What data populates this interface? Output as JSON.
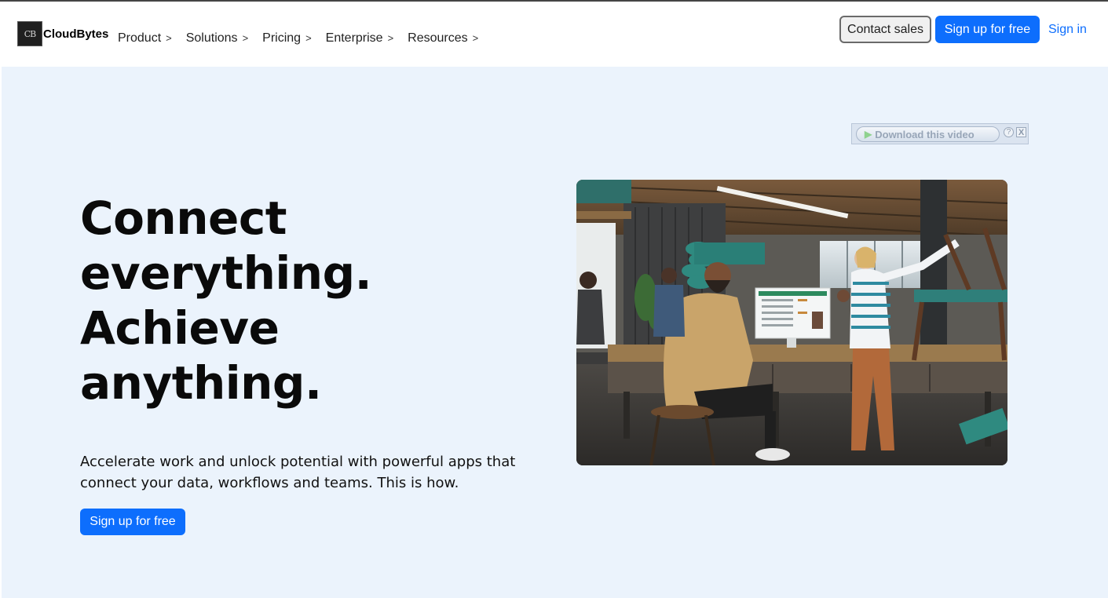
{
  "brand": {
    "logo_text": "CB",
    "name": "CloudBytes"
  },
  "nav": {
    "items": [
      {
        "label": "Product",
        "chevron": ">"
      },
      {
        "label": "Solutions",
        "chevron": ">"
      },
      {
        "label": "Pricing",
        "chevron": ">"
      },
      {
        "label": "Enterprise",
        "chevron": ">"
      },
      {
        "label": "Resources",
        "chevron": ">"
      }
    ]
  },
  "header_actions": {
    "contact_label": "Contact sales",
    "signup_label": "Sign up for free",
    "signin_label": "Sign in"
  },
  "download_bar": {
    "label": "Download this video",
    "help": "?",
    "close": "X"
  },
  "hero": {
    "headline_lines": [
      "Connect",
      "everything.",
      "Achieve",
      "anything."
    ],
    "subtext": "Accelerate work and unlock potential with powerful apps that connect your data, workflows and teams. This is how.",
    "cta_label": "Sign up for free"
  },
  "colors": {
    "accent": "#0d6efd",
    "hero_background": "#ebf3fc"
  }
}
